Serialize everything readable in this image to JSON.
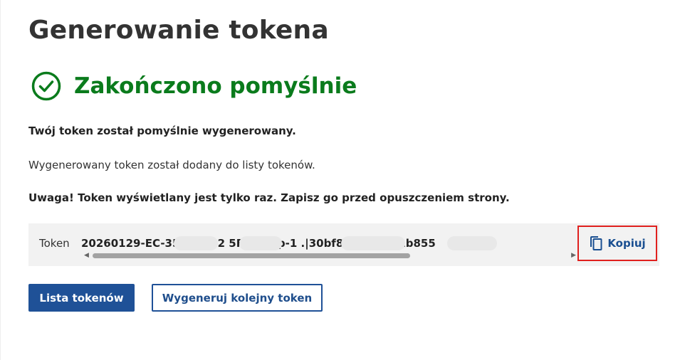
{
  "page": {
    "title": "Generowanie tokena"
  },
  "status": {
    "title": "Zakończono pomyślnie",
    "icon": "check-circle-icon",
    "color": "#0a7b1c"
  },
  "messages": {
    "generated": "Twój token został pomyślnie wygenerowany.",
    "added_to_list": "Wygenerowany token został dodany do listy tokenów.",
    "warning": "Uwaga! Token wyświetlany jest tylko raz. Zapisz go przed opuszczeniem strony."
  },
  "token": {
    "label": "Token",
    "value": "20260129-EC-354        00-12          5F-86|nip-1             .|30bf8            5ac91db1b855",
    "copy_label": "Kopiuj",
    "copy_icon": "copy-icon"
  },
  "actions": {
    "list_tokens": "Lista tokenów",
    "generate_another": "Wygeneruj kolejny token"
  },
  "colors": {
    "primary": "#1f5197",
    "success": "#0a7b1c",
    "highlight_border": "#e0201e"
  }
}
